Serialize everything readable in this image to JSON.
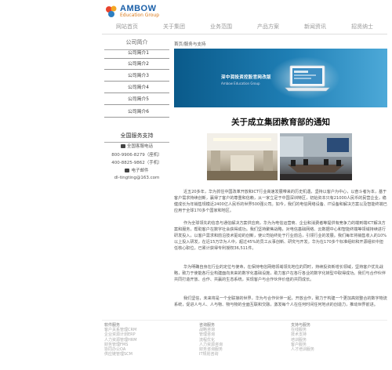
{
  "header": {
    "logo_title": "AMBOW",
    "logo_sub": "Education Group",
    "nav": [
      "网站首页",
      "关于集团",
      "业务范围",
      "产品方案",
      "新闻资讯",
      "招贤纳士"
    ]
  },
  "sidebar": {
    "heading": "公司简介",
    "items": [
      "公司简介1",
      "公司简介2",
      "公司简介3",
      "公司简介4",
      "公司简介5",
      "公司简介6"
    ]
  },
  "support": {
    "title": "全国服务支持",
    "lines": [
      "全国客服电话",
      "800-9906-8279（座机）",
      "400-8825-9862（手机）",
      "电子邮件",
      "dl-tingting@163.com"
    ]
  },
  "main": {
    "breadcrumb": "首页/服务与支持",
    "banner_text": "深中润投资控股官网改版",
    "banner_sub": "Ambow Education Group",
    "title": "关于成立集团教育部的通知",
    "paragraphs": [
      "近五20多年，华为抓住中国改革开放和ICT行业高速发展带来的历史机遇，坚持以客户为中心，以奋斗者为本，基于客户需求持续创新，赢得了客户的尊重和信赖，从一家立足于中国深圳特区，初始资本只有21000人民币的民营企业，稳健成长为年销售规模近2400亿人民币的世界500强公司。如今，我们的电信网络设备、IT设备和解决方案以及智能终端已应用于全球170多个国家和地区。",
      "作为全球领先的信息与通信解决方案供应商，华为为电信运营商、企业和消费者等提供有竞争力的端到端ICT解决方案和服务，帮助客户在数字社会获得成功。我们坚持聚焦战略，对电信基础网络、云数据中心和智能终端等领域持续进行研发投入，以客户需求和前沿技术驱动的创新，使公司始终处于行业前沿，引领行业的发展。我们每年将销售收入的10%以上投入研发，在近15万华为人中，超过45%的员工从事创新、研究与开发。华为在170多个标准组织和开源组织中担任核心职位，已累计获得专利授权36,511件。",
      "华为明确自身在行业的定位与使命，在保持电信网络领域领先地位的同时，持续投资新增长领域，坚持客户优先战略，致力于使能各行业构建面向未来的数字化基础设施，助力客户在各行各业的数字化转型中取得成功。我们与合作伙伴共同打造开放、合作、共赢的生态系统，实现客户与合作伙伴价值的共同成长。",
      "我们坚信，未来将是一个全联接的世界，华为与合作伙伴一起，开放合作，致力于构建一个更加高效整合的数字物流系统，促进人与人、人与物、物与物的全面互联和交融，激发每个人在任何时间任何地点的创造力，推动世界前进。"
    ]
  },
  "footer": {
    "columns": [
      {
        "heading": "软件服务",
        "items": [
          "客户关系管理CRM",
          "企业资源计划ERP",
          "人力资源管理HRM",
          "财务管理FMS",
          "协同办公OA",
          "供应链管理SCM"
        ]
      },
      {
        "heading": "咨询服务",
        "items": [
          "战略咨询",
          "管理咨询",
          "流程优化",
          "人力资源咨询",
          "财务咨询服务",
          "IT规划咨询"
        ]
      },
      {
        "heading": "支持与服务",
        "items": [
          "在线服务",
          "技术支持",
          "培训服务",
          "客户服务",
          "人才培训服务"
        ]
      }
    ]
  },
  "colors": {
    "brand_blue": "#1a5fa8",
    "brand_orange": "#d9791a",
    "banner_blue": "#1f7fb5"
  }
}
